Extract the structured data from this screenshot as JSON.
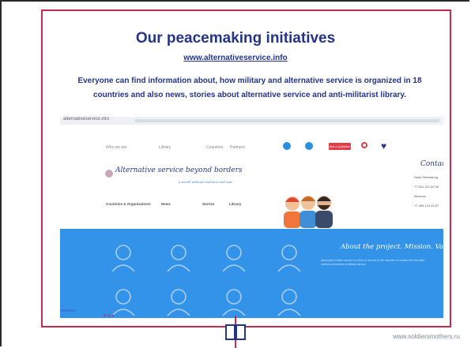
{
  "slide": {
    "heading": "Our peacemaking initiatives",
    "link": "www.alternativeservice.info",
    "description": "Everyone can find information about, how military and alternative service is organized in 18 countries and also news, stories about alternative service and anti-militarist library.",
    "footer_url": "www.soldiersmothers.ru",
    "dots": "•••"
  },
  "website": {
    "url": "alternativeservice.info",
    "nav": [
      "Who we are",
      "Library",
      "Countries",
      "Partners"
    ],
    "nav_button": "Ask a Question",
    "title": "Alternative service beyond borders",
    "subtitle": "a world without violence and war",
    "menu": [
      "Countries & Organizations",
      "News",
      "Stories",
      "Library"
    ],
    "contacts": {
      "title": "Contacts",
      "lines": [
        "Saint-Petersburg",
        "+7 812 312 42 94",
        "Moscow",
        "+7 495 123 45 67"
      ]
    },
    "about": {
      "title": "About the project. Mission. Values.",
      "text": "Alternative civilian service is a form of service in the interests of society and the state, carried out instead of military service."
    }
  },
  "colors": {
    "heading": "#25348a",
    "frame": "#c52b4d",
    "panel": "#3293e8",
    "button": "#e03c4a"
  },
  "icons": [
    "search-icon",
    "heart-icon",
    "book-icon",
    "logo-icon"
  ]
}
